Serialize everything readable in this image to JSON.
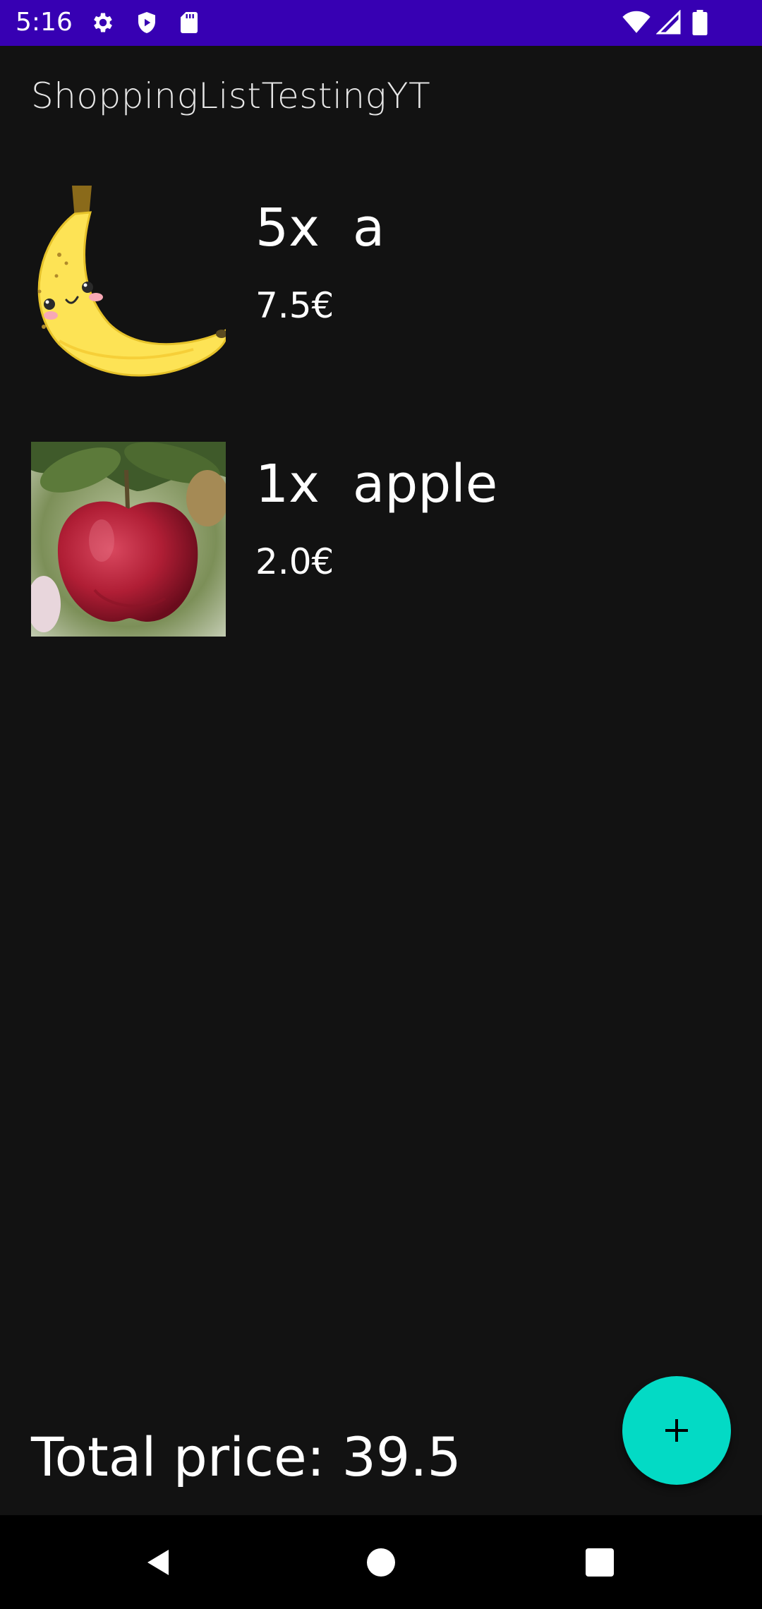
{
  "status_bar": {
    "time": "5:16",
    "left_icons": [
      "gear-icon",
      "shield-icon",
      "sd-card-icon"
    ],
    "right_icons": [
      "wifi-icon",
      "cell-signal-icon",
      "battery-icon"
    ],
    "color": "#3700b3"
  },
  "app": {
    "title": "ShoppingListTestingYT"
  },
  "items": [
    {
      "title": "5x  a",
      "price": "7.5€",
      "image": "banana-image"
    },
    {
      "title": "1x  apple",
      "price": "2.0€",
      "image": "apple-image"
    }
  ],
  "footer": {
    "total_label": "Total price: 39.5"
  },
  "fab": {
    "icon": "plus-icon",
    "color": "#03dac5"
  },
  "nav_bar": {
    "buttons": [
      "back-icon",
      "home-icon",
      "recents-icon"
    ]
  }
}
